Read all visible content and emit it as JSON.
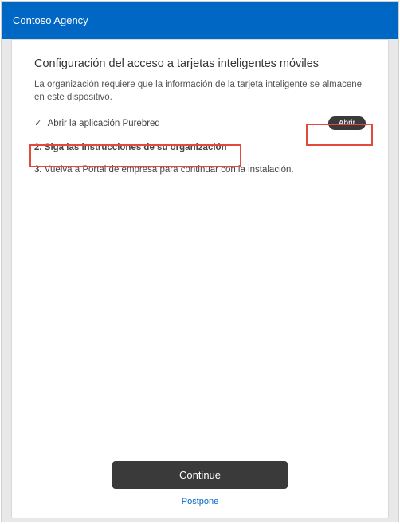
{
  "titlebar": {
    "appName": "Contoso Agency"
  },
  "page": {
    "heading": "Configuración del acceso a tarjetas inteligentes móviles",
    "subtext": "La organización requiere que la información de la tarjeta inteligente se almacene en este dispositivo.",
    "steps": {
      "step1": {
        "prefix": "✓",
        "text": "Abrir la aplicación Purebred",
        "buttonLabel": "Abrir"
      },
      "step2": {
        "prefix": "2.",
        "text": "Siga las instrucciones de su organización"
      },
      "step3": {
        "prefix": "3.",
        "text": "Vuelva a Portal de empresa para continuar con la instalación."
      }
    },
    "continueLabel": "Continue",
    "postponeLabel": "Postpone"
  },
  "colors": {
    "brand": "#0067c5",
    "highlight": "#e34a3c",
    "buttonDark": "#3a3a3a"
  }
}
